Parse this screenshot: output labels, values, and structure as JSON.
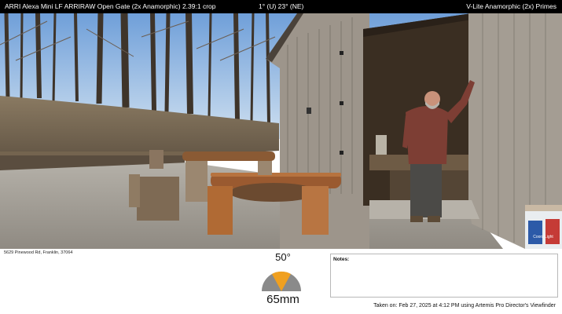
{
  "header": {
    "camera_format": "ARRI Alexa Mini LF ARRIRAW Open Gate (2x Anamorphic) 2.39:1 crop",
    "orientation": "1° (U) 23° (NE)",
    "lens_set": "V-Lite Anamorphic (2x) Primes"
  },
  "footer": {
    "address": "5629 Pinewood Rd, Franklin, 37064",
    "fov_angle": "50°",
    "focal_length": "65mm",
    "notes_label": "Notes:",
    "taken_on": "Taken on: Feb 27, 2025 at 4:12 PM using Artemis Pro Director's Viewfinder"
  },
  "photo": {
    "box_label": "Coors Light"
  },
  "colors": {
    "header_bg": "#000000",
    "fov_fill": "#f0a020",
    "fov_back": "#8a8a8a",
    "notes_border": "#b8b8b8"
  }
}
